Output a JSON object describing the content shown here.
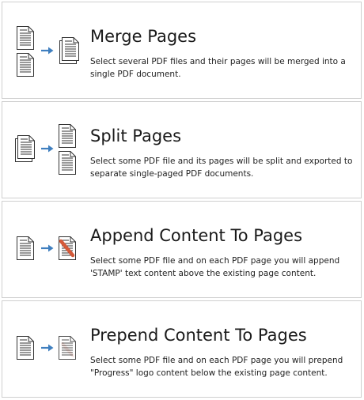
{
  "cards": [
    {
      "title": "Merge Pages",
      "description": "Select several PDF files and their pages will be merged into a single PDF document.",
      "icon": "merge-pages-icon"
    },
    {
      "title": "Split Pages",
      "description": "Select some PDF file and its pages will be split and exported to separate single-paged PDF documents.",
      "icon": "split-pages-icon"
    },
    {
      "title": "Append Content To Pages",
      "description": "Select some PDF file and on each PDF page you will append 'STAMP' text content above the existing page content.",
      "icon": "append-content-icon"
    },
    {
      "title": "Prepend Content To Pages",
      "description": "Select some PDF file and on each PDF page you will prepend \"Progress\" logo content below the existing page content.",
      "icon": "prepend-content-icon"
    }
  ],
  "colors": {
    "arrow": "#3f7fbf",
    "stamp": "#d45a3a",
    "border": "#cfcfcf",
    "page_outline": "#333333"
  }
}
